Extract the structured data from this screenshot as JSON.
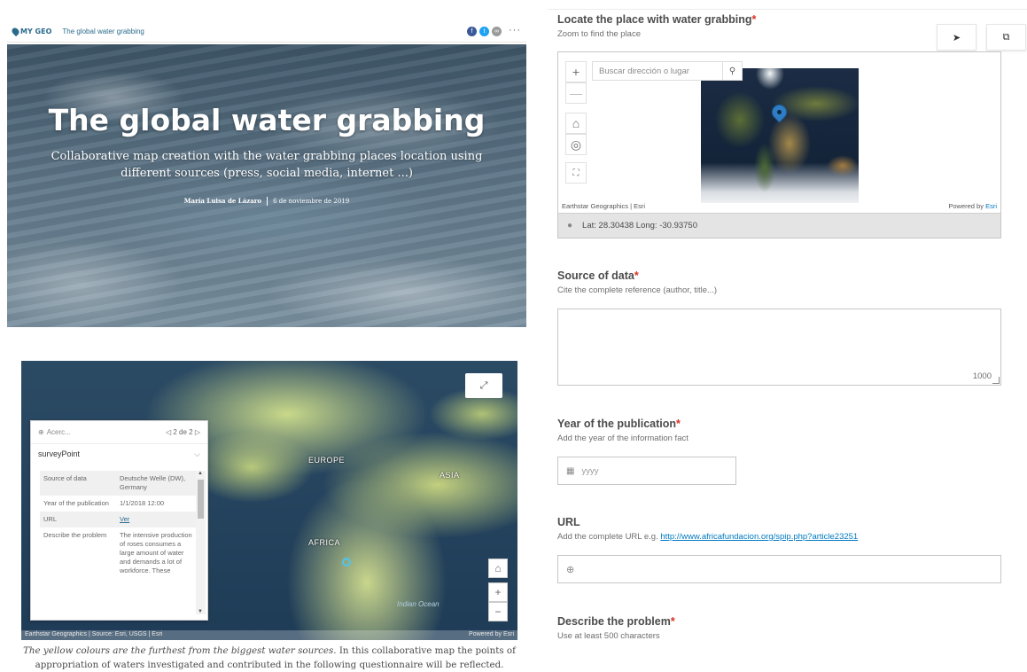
{
  "story": {
    "logo_text": "MY GEO",
    "header_title": "The global water grabbing",
    "hero_title": "The global water grabbing",
    "hero_subtitle": "Collaborative map creation with the water grabbing places location using different sources (press, social media, internet ...)",
    "author": "María Luisa de Lázaro",
    "date": "6 de noviembre de 2019",
    "more_label": "···"
  },
  "embedded_map": {
    "regions": {
      "europe": "EUROPE",
      "asia": "ASIA",
      "africa": "AFRICA"
    },
    "ocean": "Indian Ocean",
    "attribution": "Earthstar Geographics | Source: Esri, USGS | Esri",
    "powered": "Powered by Esri",
    "popup": {
      "search_placeholder": "Acerc...",
      "pager": "◁ 2 de 2 ▷",
      "layer_title": "surveyPoint",
      "rows": [
        {
          "key": "Source of data",
          "value": "Deutsche Welle (DW), Germany"
        },
        {
          "key": "Year of the publication",
          "value": "1/1/2018 12:00"
        },
        {
          "key": "URL",
          "value": "Ver"
        },
        {
          "key": "Describe the problem",
          "value": "The intensive production of roses consumes a large amount of water and demands a lot of workforce. These"
        }
      ]
    },
    "caption_italic": "The yellow colours are the furthest from the biggest water sources.",
    "caption_rest": " In this collaborative map the points of appropriation of waters investigated and contributed in the following questionnaire will be reflected."
  },
  "form": {
    "locate": {
      "label": "Locate the place with water grabbing",
      "hint": "Zoom to find the place"
    },
    "geo": {
      "search_placeholder": "Buscar dirección o lugar",
      "attribution": "Earthstar Geographics | Esri",
      "powered_prefix": "Powered by ",
      "powered_link": "Esri",
      "coords": "Lat: 28.30438  Long: -30.93750"
    },
    "source": {
      "label": "Source of data",
      "hint": "Cite the complete reference (author, title...)",
      "counter": "1000"
    },
    "year": {
      "label": "Year of the publication",
      "hint": "Add the year of the information fact",
      "placeholder": "yyyy"
    },
    "url": {
      "label": "URL",
      "hint": "Add the complete URL e.g. ",
      "hint_link": "http://www.africafundacion.org/spip.php?article23251"
    },
    "problem": {
      "label": "Describe the problem",
      "hint": "Use at least 500 characters"
    },
    "required_mark": "*"
  }
}
